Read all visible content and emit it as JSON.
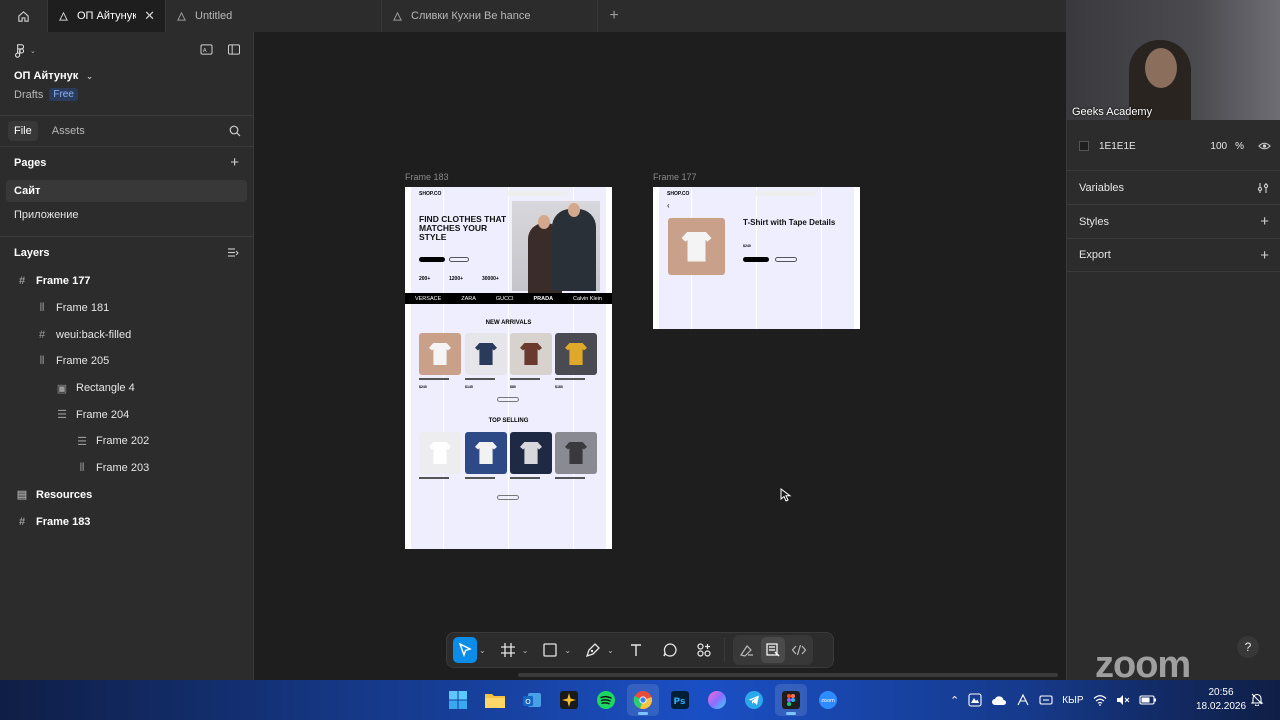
{
  "tabs": [
    {
      "label": "ОП Айтунук",
      "active": true
    },
    {
      "label": "Untitled"
    },
    {
      "label": "Сливки Кухни Be hance"
    }
  ],
  "left_panel": {
    "project_name": "ОП Айтунук",
    "drafts_label": "Drafts",
    "plan_badge": "Free",
    "tab_file": "File",
    "tab_assets": "Assets",
    "pages_heading": "Pages",
    "pages": [
      "Сайт",
      "Приложение"
    ],
    "layers_heading": "Layers",
    "layers": [
      {
        "name": "Frame 177",
        "icon": "frame-icon",
        "depth": 0
      },
      {
        "name": "Frame 181",
        "icon": "autolayout-icon",
        "depth": 1
      },
      {
        "name": "weui:back-filled",
        "icon": "frame-icon",
        "depth": 1
      },
      {
        "name": "Frame 205",
        "icon": "autolayout-icon",
        "depth": 1
      },
      {
        "name": "Rectangle 4",
        "icon": "image-icon",
        "depth": 2
      },
      {
        "name": "Frame 204",
        "icon": "autolayout-rows-icon",
        "depth": 2
      },
      {
        "name": "Frame 202",
        "icon": "autolayout-rows-icon",
        "depth": 3
      },
      {
        "name": "Frame 203",
        "icon": "autolayout-icon",
        "depth": 3
      },
      {
        "name": "Resources",
        "icon": "component-set-icon",
        "depth": 0
      },
      {
        "name": "Frame 183",
        "icon": "frame-icon",
        "depth": 0
      }
    ]
  },
  "canvas": {
    "frame183_label": "Frame 183",
    "frame177_label": "Frame 177",
    "shop": {
      "logo": "SHOP.CO",
      "hero_title": "FIND CLOTHES THAT MATCHES YOUR STYLE",
      "stats": [
        "200+",
        "1200+",
        "30000+"
      ],
      "brands": [
        "VERSACE",
        "ZARA",
        "GUCCI",
        "PRADA",
        "Calvin Klein"
      ],
      "new_arrivals": "NEW ARRIVALS",
      "top_selling": "TOP SELLING",
      "prices": [
        "$240",
        "$145",
        "$80",
        "$180"
      ]
    },
    "detail": {
      "logo": "SHOP.CO",
      "product_title": "T-Shirt with Tape Details",
      "price": "$240"
    }
  },
  "right_panel": {
    "video_name": "Geeks Academy",
    "fill_hex": "1E1E1E",
    "fill_opacity": "100",
    "fill_unit": "%",
    "sections": [
      "Variables",
      "Styles",
      "Export"
    ],
    "watermark": "zoom",
    "help": "?"
  },
  "taskbar": {
    "lang": "КЫР",
    "time": "20:56",
    "date": "18.02.2026"
  },
  "colors": {
    "accent": "#0c8ce9",
    "canvas_bg": "#1e1e1e",
    "panel_bg": "#2c2c2c"
  }
}
